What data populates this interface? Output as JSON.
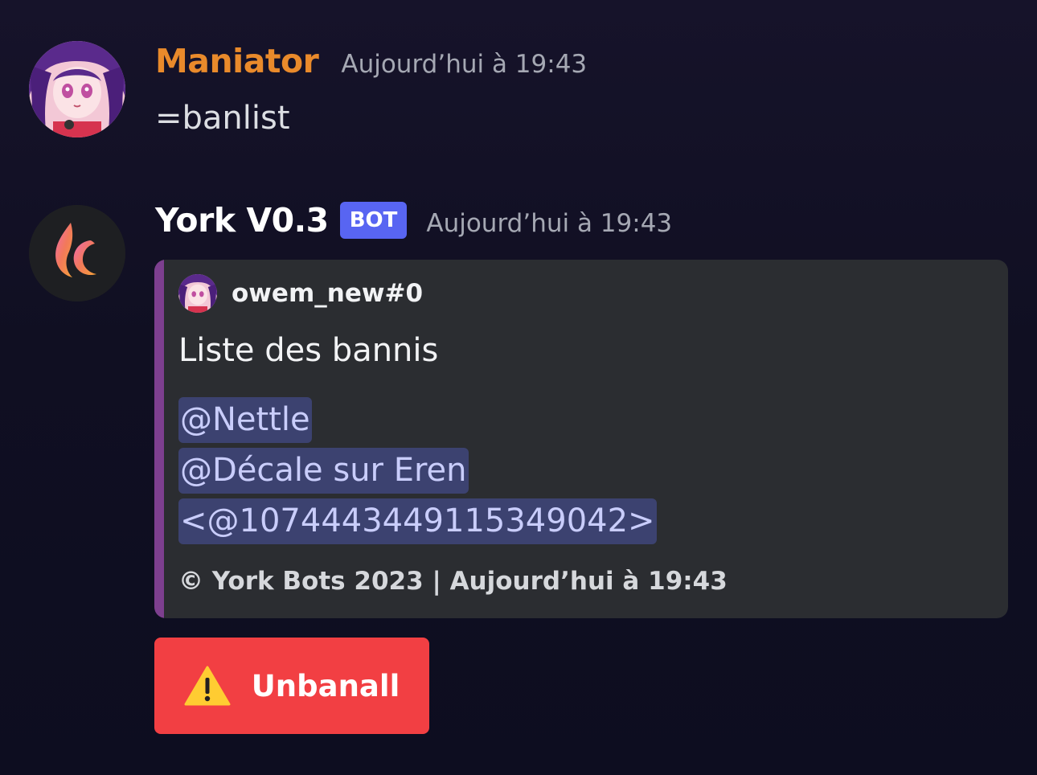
{
  "colors": {
    "user_name_color": "#e98a2b",
    "bot_name_color": "#ffffff",
    "bot_tag_bg": "#5865f2",
    "embed_bar": "#7d3f8f",
    "embed_bg": "#2b2d31",
    "mention_bg": "#3c4270",
    "mention_text": "#c9cdfb",
    "danger_button": "#f23f43"
  },
  "messages": [
    {
      "author": "Maniator",
      "timestamp": "Aujourd’hui à 19:43",
      "avatar_icon": "anime-girl-avatar",
      "content": "=banlist"
    },
    {
      "author": "York V0.3",
      "bot_tag": "BOT",
      "timestamp": "Aujourd’hui à 19:43",
      "avatar_icon": "flame-logo-avatar",
      "embed": {
        "author_name": "owem_new#0",
        "author_icon": "anime-girl-avatar",
        "title": "Liste des bannis",
        "mentions": [
          "@Nettle",
          "@Décale sur Eren",
          "<@1074443449115349042>"
        ],
        "footer": "© York Bots 2023 | Aujourd’hui à 19:43"
      },
      "button": {
        "icon": "warning-icon",
        "label": "Unbanall"
      }
    }
  ]
}
